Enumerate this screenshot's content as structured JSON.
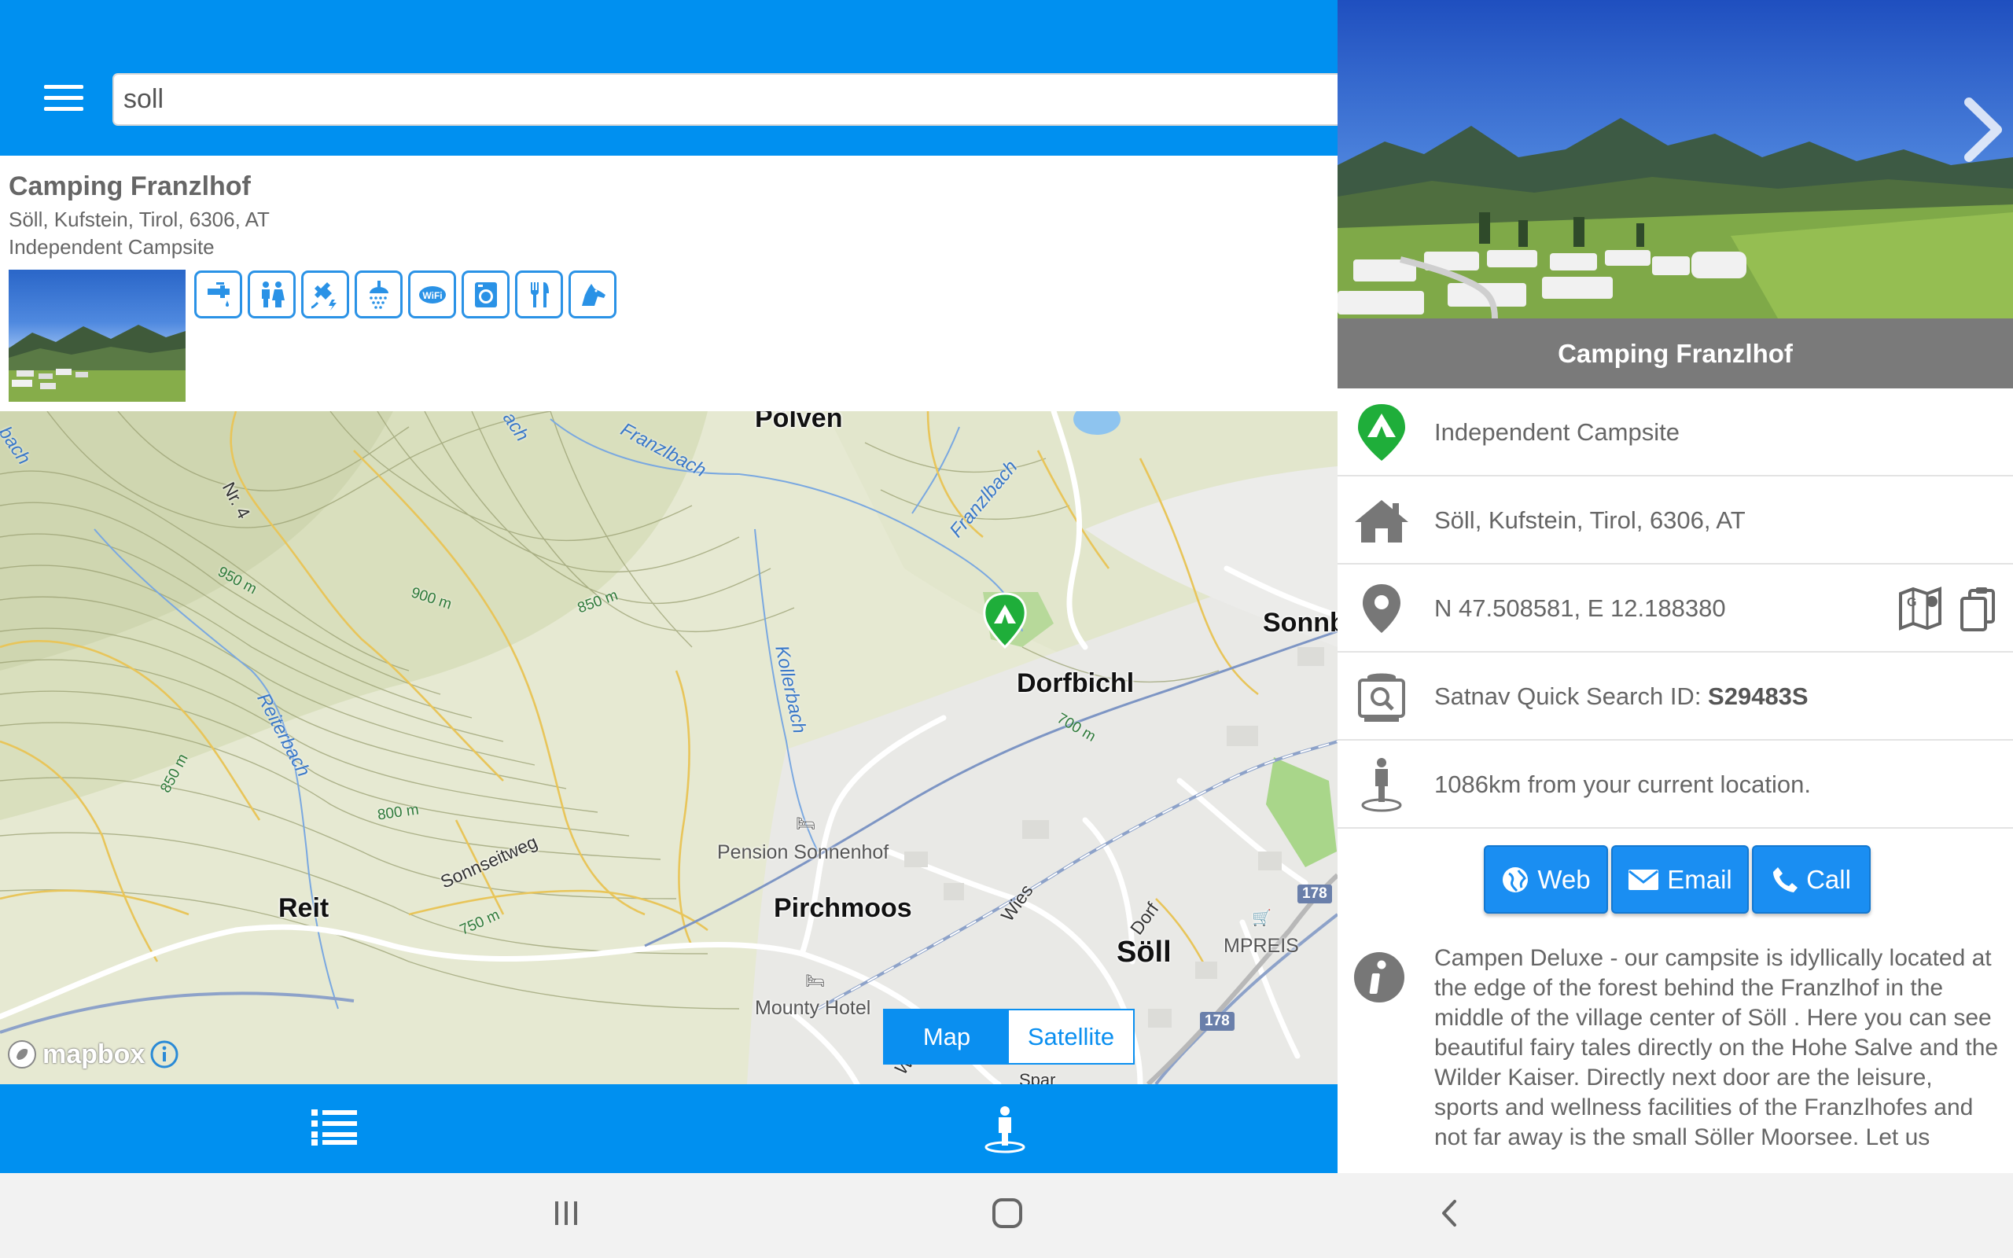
{
  "search": {
    "value": "soll"
  },
  "result": {
    "title": "Camping Franzlhof",
    "address": "Söll, Kufstein, Tirol, 6306, AT",
    "type": "Independent Campsite",
    "amenities": [
      "tap-water-icon",
      "toilets-icon",
      "electric-hookup-icon",
      "shower-icon",
      "wifi-icon",
      "laundry-icon",
      "restaurant-icon",
      "dogs-allowed-icon"
    ]
  },
  "map": {
    "places": [
      "Pölven",
      "Sonnb",
      "Dorfbichl",
      "Reit",
      "Pirchmoos",
      "Söll"
    ],
    "pois": [
      "Pension Sonnenhof",
      "Mounty Hotel",
      "MPREIS"
    ],
    "contours": [
      "950 m",
      "900 m",
      "850 m",
      "850 m",
      "800 m",
      "750 m",
      "700 m"
    ],
    "waterways": [
      "Franzlbach",
      "Franzlbach",
      "Kollerbach",
      "Reiterbach",
      "bach",
      "ach"
    ],
    "roads": [
      "Nr. 4",
      "Sonnseitweg",
      "Wies",
      "Dorf",
      "Wie",
      "Spar"
    ],
    "shields": [
      "178",
      "178"
    ],
    "toggle": {
      "map": "Map",
      "satellite": "Satellite"
    },
    "attribution": "mapbox"
  },
  "detail": {
    "title": "Camping Franzlhof",
    "type": "Independent Campsite",
    "address": "Söll, Kufstein, Tirol, 6306, AT",
    "coords": "N 47.508581, E 12.188380",
    "satnav_label": "Satnav Quick Search ID: ",
    "satnav_id": "S29483S",
    "distance": "1086km from your current location.",
    "buttons": {
      "web": "Web",
      "email": "Email",
      "call": "Call"
    },
    "description": "Campen Deluxe - our campsite is idyllically located at the edge of the forest behind the Franzlhof in the middle of the village center of Söll . Here you can see beautiful fairy tales directly on the Hohe Salve and the Wilder Kaiser. Directly next door are the leisure, sports and wellness facilities of the Franzlhofes and not far away is the small Söller Moorsee. Let us"
  },
  "colors": {
    "accent": "#0090f0",
    "campsite_pin": "#1fae3a",
    "title_bar": "#7a7a7a"
  }
}
